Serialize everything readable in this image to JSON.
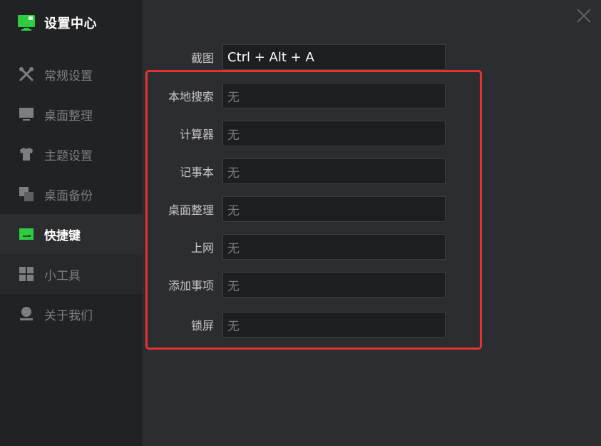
{
  "window": {
    "title": "设置中心"
  },
  "sidebar": {
    "items": [
      {
        "label": "常规设置",
        "icon": "tools-icon"
      },
      {
        "label": "桌面整理",
        "icon": "monitor-icon"
      },
      {
        "label": "主题设置",
        "icon": "shirt-icon"
      },
      {
        "label": "桌面备份",
        "icon": "copy-icon"
      },
      {
        "label": "快捷键",
        "icon": "keyboard-icon",
        "active": true
      },
      {
        "label": "小工具",
        "icon": "grid-icon"
      },
      {
        "label": "关于我们",
        "icon": "user-icon"
      }
    ]
  },
  "shortcuts": [
    {
      "label": "截图",
      "value": "Ctrl + Alt + A"
    },
    {
      "label": "本地搜索",
      "value": "无"
    },
    {
      "label": "计算器",
      "value": "无"
    },
    {
      "label": "记事本",
      "value": "无"
    },
    {
      "label": "桌面整理",
      "value": "无"
    },
    {
      "label": "上网",
      "value": "无"
    },
    {
      "label": "添加事项",
      "value": "无"
    },
    {
      "label": "锁屏",
      "value": "无"
    }
  ],
  "colors": {
    "accent": "#2ecc40",
    "highlight": "#e53232",
    "sidebar_bg": "#212224",
    "content_bg": "#2c2d30"
  }
}
